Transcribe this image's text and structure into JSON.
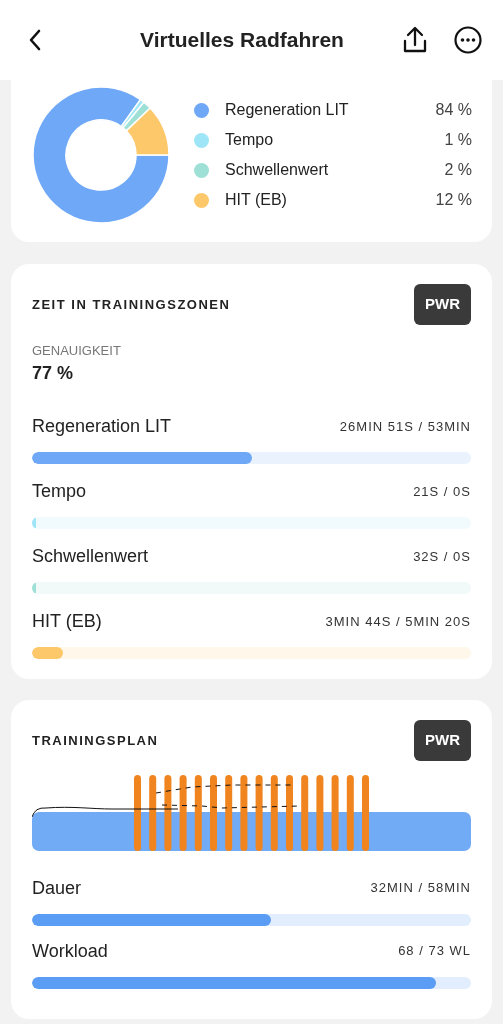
{
  "header": {
    "title": "Virtuelles Radfahren"
  },
  "distribution": {
    "legend": [
      {
        "value": "84 %",
        "color": "#6fa8f7"
      },
      {
        "value": "1 %",
        "color": "#9ee6f7"
      },
      {
        "value": "2 %",
        "color": "#9ee0d6"
      },
      {
        "value": "12 %",
        "color": "#fcc86a"
      }
    ],
    "chart_data": {
      "type": "donut",
      "categories": [
        "Regeneration LIT",
        "Tempo",
        "Schwellenwert",
        "HIT (EB)"
      ],
      "values": [
        84,
        1,
        2,
        12
      ]
    }
  },
  "zones": {
    "title": "ZEIT IN TRAININGSZONEN",
    "badge": "PWR",
    "accuracy_label": "GENAUIGKEIT",
    "accuracy_value": "77 %",
    "items": [
      {
        "label": "Regeneration LIT",
        "reading": "26MIN 51S / 53MIN",
        "level": 0.5,
        "color": "#6fa8f7"
      },
      {
        "label": "Tempo",
        "reading": "21S / 0S",
        "level": 0.01,
        "color": "#9ee6f7"
      },
      {
        "label": "Schwellenwert",
        "reading": "32S / 0S",
        "level": 0.01,
        "color": "#9ee0d6"
      },
      {
        "label": "HIT (EB)",
        "reading": "3MIN 44S / 5MIN 20S",
        "level": 0.07,
        "color": "#fcc86a"
      }
    ]
  },
  "plan": {
    "title": "TRAININGSPLAN",
    "badge": "PWR",
    "metrics": [
      {
        "label": "Dauer",
        "reading": "32MIN / 58MIN",
        "level": 0.545
      },
      {
        "label": "Workload",
        "reading": "68 / 73 WL",
        "level": 0.92
      }
    ]
  }
}
